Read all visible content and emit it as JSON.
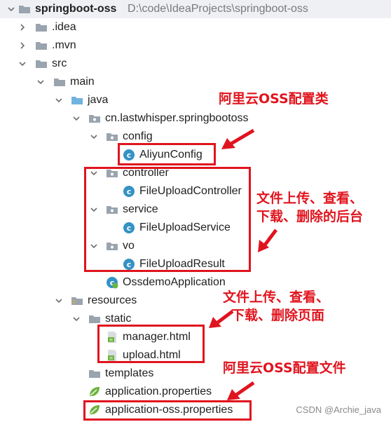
{
  "project": {
    "name": "springboot-oss",
    "path": "D:\\code\\IdeaProjects\\springboot-oss"
  },
  "tree": {
    "idea": ".idea",
    "mvn": ".mvn",
    "src": "src",
    "main": "main",
    "java": "java",
    "package": "cn.lastwhisper.springbootoss",
    "config": "config",
    "aliyun_config": "AliyunConfig",
    "controller": "controller",
    "file_upload_controller": "FileUploadController",
    "service": "service",
    "file_upload_service": "FileUploadService",
    "vo": "vo",
    "file_upload_result": "FileUploadResult",
    "ossdemo_application": "OssdemoApplication",
    "resources": "resources",
    "static": "static",
    "manager_html": "manager.html",
    "upload_html": "upload.html",
    "templates": "templates",
    "application_properties": "application.properties",
    "application_oss_properties": "application-oss.properties"
  },
  "annotations": {
    "oss_config_class": "阿里云OSS配置类",
    "backend_line1": "文件上传、查看、",
    "backend_line2": "下载、删除的后台",
    "pages_line1": "文件上传、查看、",
    "pages_line2": "下载、删除页面",
    "oss_config_file": "阿里云OSS配置文件"
  },
  "watermark": "CSDN @Archie_java",
  "colors": {
    "annotation_red": "#e0141e",
    "folder_gray": "#9aa4ae",
    "source_folder_blue": "#6fb3e0",
    "class_blue": "#3592c4",
    "spring_green": "#6db33f"
  }
}
